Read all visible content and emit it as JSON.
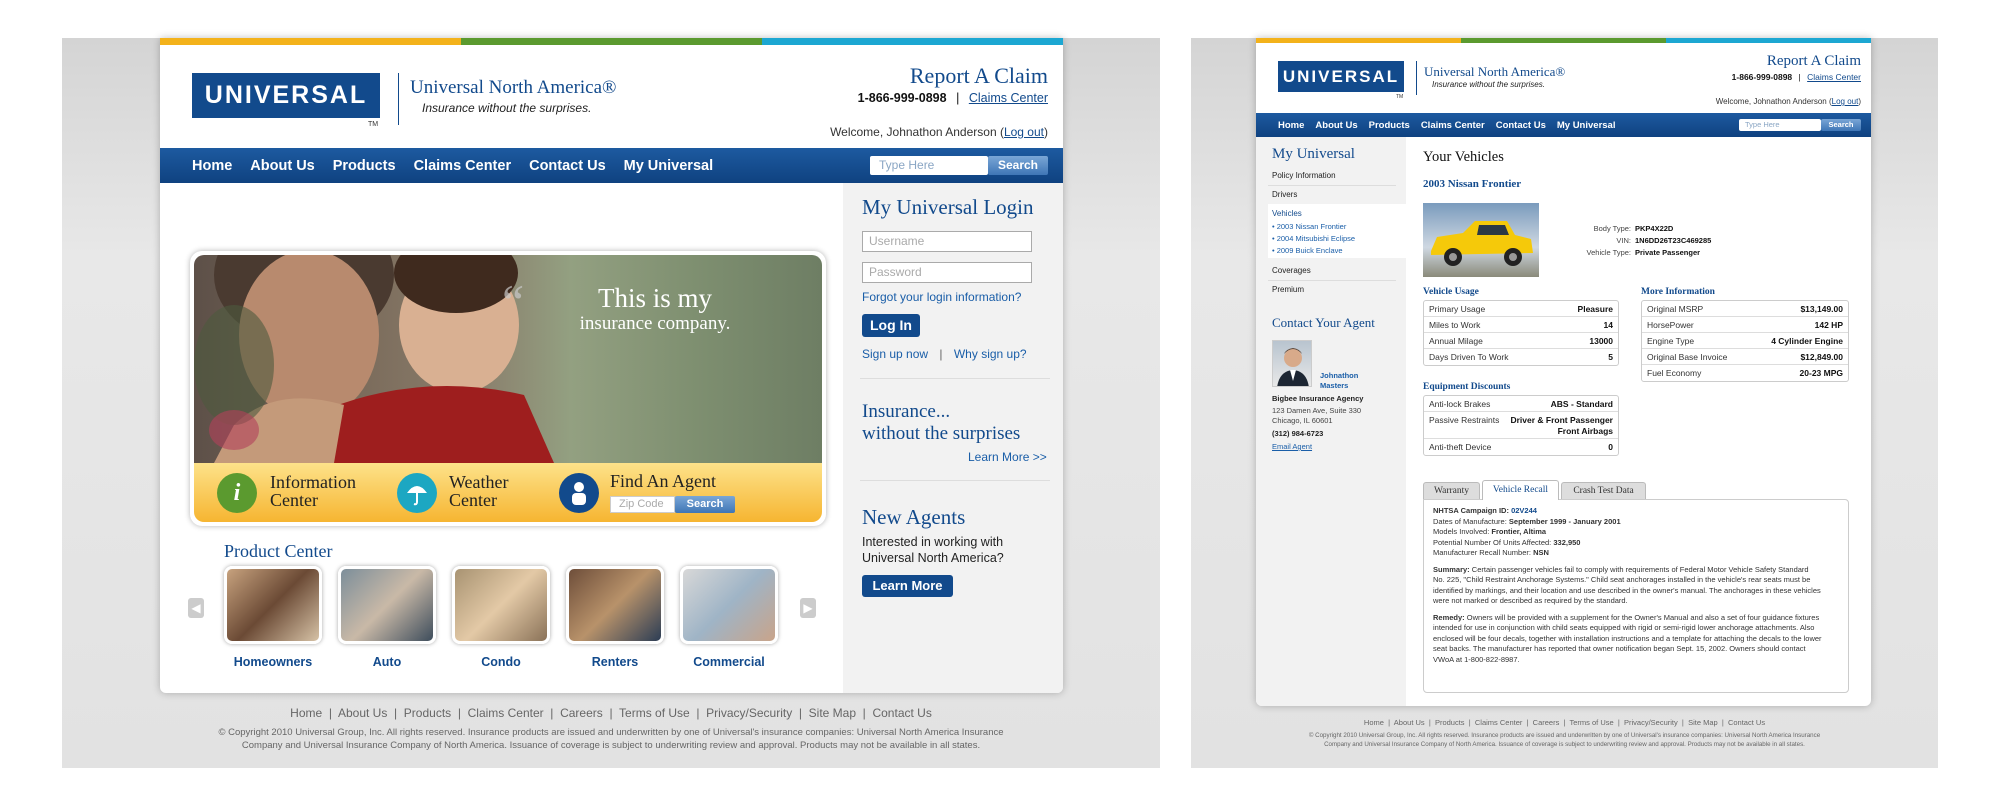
{
  "colors": {
    "brand": "#124a8c",
    "stripe": [
      "#f3b21b",
      "#5b9a2f",
      "#1ca7d2"
    ]
  },
  "left": {
    "logo": "UNIVERSAL",
    "tm": "TM",
    "brand_name": "Universal North America®",
    "tagline": "Insurance without the surprises.",
    "report_claim": "Report A Claim",
    "phone": "1-866-999-0898",
    "pipe": "|",
    "claims_center_link": "Claims Center",
    "welcome": "Welcome, Johnathon Anderson (",
    "logout": "Log out",
    "welcome_end": ")",
    "nav": [
      "Home",
      "About Us",
      "Products",
      "Claims Center",
      "Contact Us",
      "My Universal"
    ],
    "search_placeholder": "Type Here",
    "search_btn": "Search",
    "hero_line1": "This is my",
    "hero_line2": "insurance company.",
    "info_center": [
      "Information",
      "Center"
    ],
    "weather_center": [
      "Weather",
      "Center"
    ],
    "find_agent": "Find An Agent",
    "zip_placeholder": "Zip Code",
    "zip_search": "Search",
    "login_title": "My Universal Login",
    "username_ph": "Username",
    "password_ph": "Password",
    "forgot": "Forgot your login information?",
    "login_btn": "Log In",
    "signup": "Sign up now",
    "why": "Why sign up?",
    "insurance1": "Insurance...",
    "insurance2": "without the surprises",
    "learn_more_link": "Learn More >>",
    "new_agents": "New Agents",
    "agents_text1": "Interested in working with",
    "agents_text2": "Universal North America?",
    "learn_more_btn": "Learn More",
    "product_center": "Product Center",
    "products": [
      "Homeowners",
      "Auto",
      "Condo",
      "Renters",
      "Commercial"
    ],
    "footer_links": [
      "Home",
      "About Us",
      "Products",
      "Claims Center",
      "Careers",
      "Terms of Use",
      "Privacy/Security",
      "Site Map",
      "Contact Us"
    ],
    "copyright1": "© Copyright 2010 Universal Group, Inc. All rights reserved. Insurance products are issued and underwritten by one of Universal's insurance companies: Universal North America Insurance",
    "copyright2": "Company and Universal Insurance Company of North America. Issuance of coverage is subject to underwriting review and approval. Products may not be available in all states."
  },
  "right": {
    "logo": "UNIVERSAL",
    "tm": "TM",
    "brand_name": "Universal North America®",
    "tagline": "Insurance without the surprises.",
    "report_claim": "Report A Claim",
    "phone": "1-866-999-0898",
    "claims_center_link": "Claims Center",
    "welcome": "Welcome, Johnathon Anderson (",
    "logout": "Log out",
    "nav": [
      "Home",
      "About Us",
      "Products",
      "Claims Center",
      "Contact Us",
      "My Universal"
    ],
    "search_placeholder": "Type Here",
    "search_btn": "Search",
    "sidebar_title": "My Universal",
    "sidebar_items": [
      "Policy Information",
      "Drivers",
      "Vehicles"
    ],
    "vehicle_links": [
      "• 2003 Nissan Frontier",
      "• 2004 Mitsubishi Eclipse",
      "• 2009 Buick Enclave"
    ],
    "sidebar_items2": [
      "Coverages",
      "Premium"
    ],
    "contact_agent": "Contact Your Agent",
    "agent_name1": "Johnathon",
    "agent_name2": "Masters",
    "agency": "Bigbee Insurance Agency",
    "addr1": "123 Damen Ave, Suite 330",
    "addr2": "Chicago, IL 60601",
    "agent_phone": "(312) 984-6723",
    "email_agent": "Email Agent",
    "your_vehicles": "Your Vehicles",
    "vehicle_title": "2003 Nissan Frontier",
    "specs": [
      {
        "k": "Body Type:",
        "v": "PKP4X22D"
      },
      {
        "k": "VIN:",
        "v": "1N6DD26T23C469285"
      },
      {
        "k": "Vehicle Type:",
        "v": "Private Passenger"
      }
    ],
    "vehicle_usage": "Vehicle Usage",
    "usage": [
      {
        "k": "Primary Usage",
        "v": "Pleasure"
      },
      {
        "k": "Miles to Work",
        "v": "14"
      },
      {
        "k": "Annual Milage",
        "v": "13000"
      },
      {
        "k": "Days Driven To Work",
        "v": "5"
      }
    ],
    "more_info": "More Information",
    "info": [
      {
        "k": "Original MSRP",
        "v": "$13,149.00"
      },
      {
        "k": "HorsePower",
        "v": "142 HP"
      },
      {
        "k": "Engine Type",
        "v": "4 Cylinder Engine"
      },
      {
        "k": "Original Base Invoice",
        "v": "$12,849.00"
      },
      {
        "k": "Fuel Economy",
        "v": "20-23 MPG"
      }
    ],
    "equip_title": "Equipment Discounts",
    "equip": [
      {
        "k": "Anti-lock Brakes",
        "v": "ABS - Standard"
      },
      {
        "k": "Passive Restraints",
        "v": "Driver & Front Passenger",
        "v2": "Front Airbags"
      },
      {
        "k": "Anti-theft Device",
        "v": "0"
      }
    ],
    "tabs": [
      "Warranty",
      "Vehicle Recall",
      "Crash Test Data"
    ],
    "recall": [
      {
        "k": "NHTSA Campaign ID:",
        "v": "02V244"
      },
      {
        "k": "Dates of Manufacture:",
        "v": "September 1999 - January 2001"
      },
      {
        "k": "Models Involved:",
        "v": "Frontier, Altima"
      },
      {
        "k": "Potential Number Of Units Affected:",
        "v": "332,950"
      },
      {
        "k": "Manufacturer Recall Number:",
        "v": "NSN"
      }
    ],
    "summary_label": "Summary:",
    "summary": [
      " Certain passenger vehicles fail to comply with requirements of Federal Motor Vehicle Safety Standard",
      "No. 225, \"Child Restraint Anchorage Systems.\" Child seat anchorages installed in the vehicle's rear seats must be",
      "identified by markings, and their location and use described in the owner's manual. The anchorages in these vehicles",
      "were not marked or described as required by the standard."
    ],
    "remedy_label": "Remedy:",
    "remedy": [
      " Owners will be provided with a supplement for the Owner's Manual and also a set of four guidance fixtures",
      "intended for use in conjunction with child seats equipped with rigid or semi-rigid lower anchorage attachments. Also",
      "enclosed will be four decals, together with installation instructions and a template for attaching the decals to the lower",
      "seat backs. The manufacturer has reported that owner notification began Sept. 15, 2002. Owners should contact",
      "VWoA at 1-800-822-8987."
    ],
    "footer_links": [
      "Home",
      "About Us",
      "Products",
      "Claims Center",
      "Careers",
      "Terms of Use",
      "Privacy/Security",
      "Site Map",
      "Contact Us"
    ],
    "copyright1": "© Copyright 2010 Universal Group, Inc. All rights reserved. Insurance products are issued and underwritten by one of Universal's insurance companies: Universal North America Insurance",
    "copyright2": "Company and Universal Insurance Company of North America. Issuance of coverage is subject to underwriting review and approval. Products may not be available in all states."
  }
}
